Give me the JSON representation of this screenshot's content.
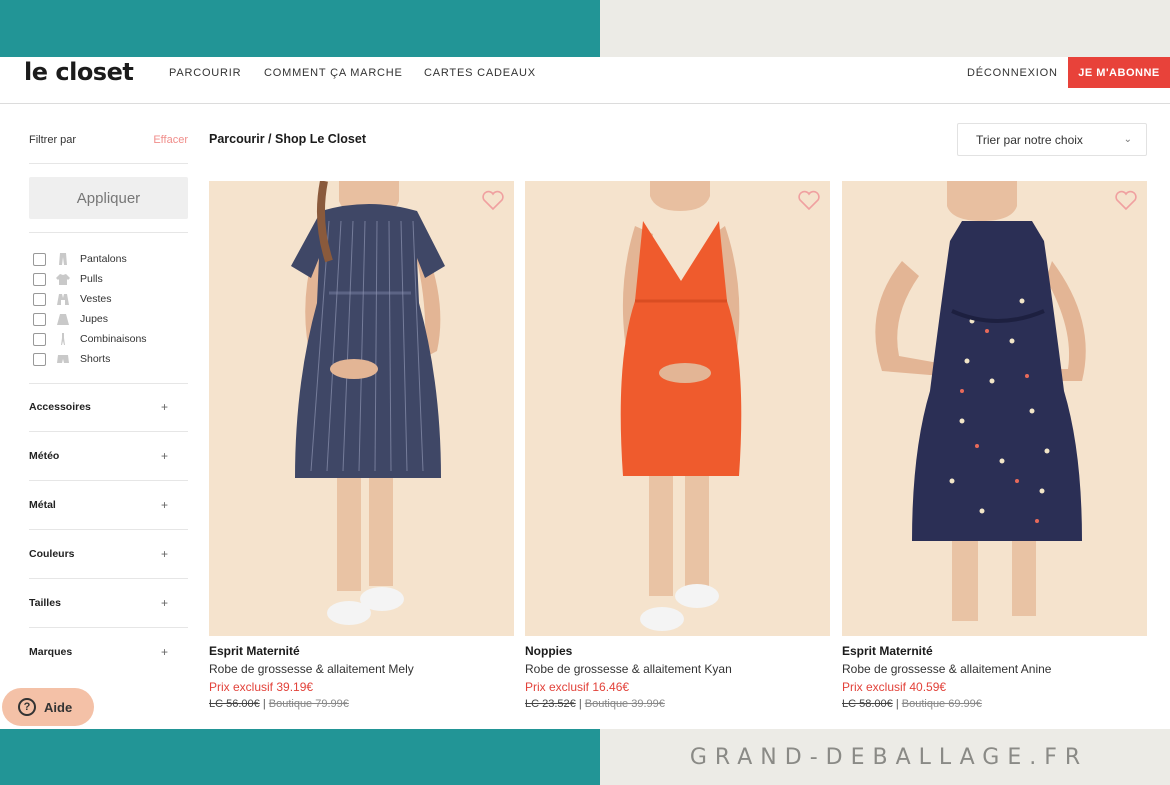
{
  "brand": {
    "logo": "le closet"
  },
  "nav": {
    "browse": "PARCOURIR",
    "how_it_works": "COMMENT ÇA MARCHE",
    "gift_cards": "CARTES CADEAUX",
    "logout": "DÉCONNEXION",
    "subscribe": "JE M'ABONNE"
  },
  "colors": {
    "accent": "#e8423a",
    "frame_teal": "#229596",
    "photo_bg": "#f5e3cd"
  },
  "sidebar": {
    "filter_by": "Filtrer par",
    "clear": "Effacer",
    "apply": "Appliquer",
    "categories": [
      {
        "label": "Pantalons",
        "icon": "pants-icon"
      },
      {
        "label": "Pulls",
        "icon": "sweater-icon"
      },
      {
        "label": "Vestes",
        "icon": "jacket-icon"
      },
      {
        "label": "Jupes",
        "icon": "skirt-icon"
      },
      {
        "label": "Combinaisons",
        "icon": "jumpsuit-icon"
      },
      {
        "label": "Shorts",
        "icon": "shorts-icon"
      }
    ],
    "sections": [
      "Accessoires",
      "Météo",
      "Métal",
      "Couleurs",
      "Tailles",
      "Marques"
    ]
  },
  "main": {
    "breadcrumb": "Parcourir / Shop Le Closet",
    "sort": "Trier par notre choix",
    "products": [
      {
        "brand": "Esprit Maternité",
        "name": "Robe de grossesse & allaitement Mely",
        "price": "Prix exclusif 39.19€",
        "lc_price": "LC 56.00€",
        "separator": " | ",
        "boutique_price": "Boutique 79.99€",
        "dress_color": "#3f4766"
      },
      {
        "brand": "Noppies",
        "name": "Robe de grossesse & allaitement Kyan",
        "price": "Prix exclusif 16.46€",
        "lc_price": "LC 23.52€",
        "separator": " | ",
        "boutique_price": "Boutique 39.99€",
        "dress_color": "#ef5b2d"
      },
      {
        "brand": "Esprit Maternité",
        "name": "Robe de grossesse & allaitement Anine",
        "price": "Prix exclusif 40.59€",
        "lc_price": "LC 58.00€",
        "separator": " | ",
        "boutique_price": "Boutique 69.99€",
        "dress_color": "#2b2f55"
      }
    ]
  },
  "help": {
    "label": "Aide"
  },
  "watermark": "GRAND-DEBALLAGE.FR"
}
